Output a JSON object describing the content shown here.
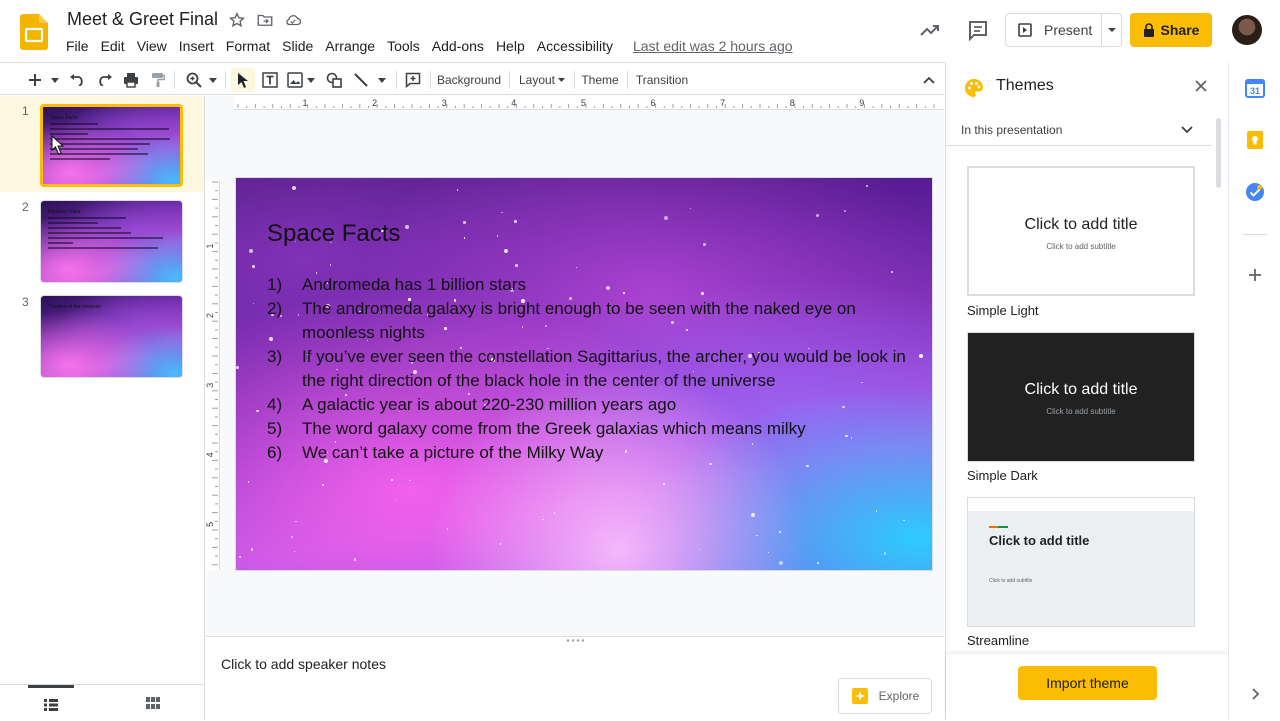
{
  "header": {
    "doc_title": "Meet & Greet Final",
    "menu": [
      "File",
      "Edit",
      "View",
      "Insert",
      "Format",
      "Slide",
      "Arrange",
      "Tools",
      "Add-ons",
      "Help",
      "Accessibility"
    ],
    "last_edit": "Last edit was 2 hours ago",
    "present_label": "Present",
    "share_label": "Share"
  },
  "toolbar": {
    "background_label": "Background",
    "layout_label": "Layout",
    "theme_label": "Theme",
    "transition_label": "Transition"
  },
  "filmstrip": {
    "slides": [
      {
        "number": "1",
        "title": "Space Facts"
      },
      {
        "number": "2",
        "title": "Random Trivia"
      },
      {
        "number": "3",
        "title": "Timeline of the universe"
      }
    ]
  },
  "slide": {
    "title": "Space Facts",
    "items": [
      {
        "num": "1)",
        "text": "Andromeda has 1 billion stars"
      },
      {
        "num": "2)",
        "text": "The andromeda galaxy is bright enough to be seen with the naked eye on moonless nights"
      },
      {
        "num": "3)",
        "text": "If you’ve ever seen the constellation Sagittarius, the archer, you would be look in the right direction of the black hole in the center of the universe"
      },
      {
        "num": "4)",
        "text": "A galactic year is about 220-230 million years ago"
      },
      {
        "num": "5)",
        "text": "The word galaxy come from the Greek galaxias which means milky"
      },
      {
        "num": "6)",
        "text": "We can’t take a picture of the Milky Way"
      }
    ]
  },
  "ruler": {
    "h_labels": [
      "1",
      "2",
      "3",
      "4",
      "5",
      "6",
      "7",
      "8",
      "9"
    ],
    "v_labels": [
      "1",
      "2",
      "3",
      "4",
      "5"
    ]
  },
  "notes": {
    "placeholder": "Click to add speaker notes",
    "explore_label": "Explore"
  },
  "themes": {
    "title": "Themes",
    "filter_label": "In this presentation",
    "cards": [
      {
        "name": "Simple Light",
        "title": "Click to add title",
        "subtitle": "Click to add subtitle"
      },
      {
        "name": "Simple Dark",
        "title": "Click to add title",
        "subtitle": "Click to add subtitle"
      },
      {
        "name": "Streamline",
        "title": "Click to add title",
        "subtitle": "Click to add subtitle"
      }
    ],
    "import_label": "Import theme"
  },
  "colors": {
    "accent": "#fbbc04",
    "selected_row": "#fef7e0"
  }
}
